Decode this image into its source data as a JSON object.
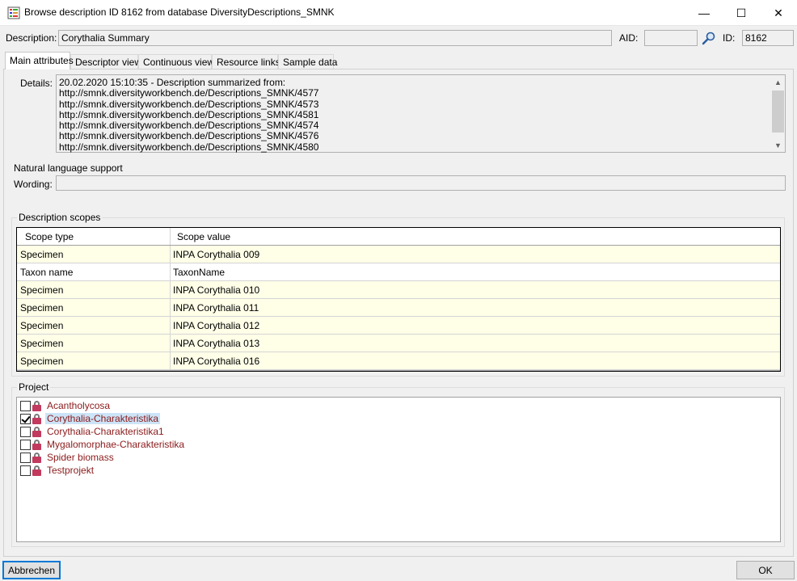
{
  "window": {
    "title": "Browse description ID 8162 from database DiversityDescriptions_SMNK",
    "app_icon": "grid-list-icon",
    "minimize_glyph": "—",
    "maximize_glyph": "☐",
    "close_glyph": "✕"
  },
  "header": {
    "description_label": "Description:",
    "description_value": "Corythalia Summary",
    "aid_label": "AID:",
    "aid_value": "",
    "search_icon": "magnifier-icon",
    "id_label": "ID:",
    "id_value": "8162"
  },
  "tabs": [
    {
      "label": "Main attributes",
      "active": true
    },
    {
      "label": "Descriptor view",
      "active": false
    },
    {
      "label": "Continuous view",
      "active": false
    },
    {
      "label": "Resource links",
      "active": false
    },
    {
      "label": "Sample data",
      "active": false
    }
  ],
  "details": {
    "label": "Details:",
    "text": "20.02.2020 15:10:35 - Description summarized from:\nhttp://smnk.diversityworkbench.de/Descriptions_SMNK/4577\nhttp://smnk.diversityworkbench.de/Descriptions_SMNK/4573\nhttp://smnk.diversityworkbench.de/Descriptions_SMNK/4581\nhttp://smnk.diversityworkbench.de/Descriptions_SMNK/4574\nhttp://smnk.diversityworkbench.de/Descriptions_SMNK/4576\nhttp://smnk.diversityworkbench.de/Descriptions_SMNK/4580"
  },
  "natural_language": {
    "title": "Natural language support",
    "wording_label": "Wording:",
    "wording_value": ""
  },
  "scopes": {
    "title": "Description scopes",
    "columns": [
      "Scope type",
      "Scope value"
    ],
    "row_color_tinted": "#ffffe8",
    "row_color_white": "#ffffff",
    "rows": [
      {
        "type": "Specimen",
        "value": "INPA Corythalia 009",
        "tinted": true
      },
      {
        "type": "Taxon name",
        "value": "TaxonName",
        "tinted": false
      },
      {
        "type": "Specimen",
        "value": "INPA Corythalia 010",
        "tinted": true
      },
      {
        "type": "Specimen",
        "value": "INPA Corythalia 011",
        "tinted": true
      },
      {
        "type": "Specimen",
        "value": "INPA Corythalia 012",
        "tinted": true
      },
      {
        "type": "Specimen",
        "value": "INPA Corythalia 013",
        "tinted": true
      },
      {
        "type": "Specimen",
        "value": "INPA Corythalia 016",
        "tinted": true
      }
    ]
  },
  "project": {
    "title": "Project",
    "items": [
      {
        "label": "Acantholycosa",
        "checked": false,
        "selected": false
      },
      {
        "label": "Corythalia-Charakteristika",
        "checked": true,
        "selected": true
      },
      {
        "label": "Corythalia-Charakteristika1",
        "checked": false,
        "selected": false
      },
      {
        "label": "Mygalomorphae-Charakteristika",
        "checked": false,
        "selected": false
      },
      {
        "label": "Spider biomass",
        "checked": false,
        "selected": false
      },
      {
        "label": "Testprojekt",
        "checked": false,
        "selected": false
      }
    ]
  },
  "buttons": {
    "cancel_label": "Abbrechen",
    "ok_label": "OK"
  },
  "colors": {
    "accent": "#0078d7",
    "project_text": "#8b1a1a",
    "selection": "#cce4f7"
  }
}
